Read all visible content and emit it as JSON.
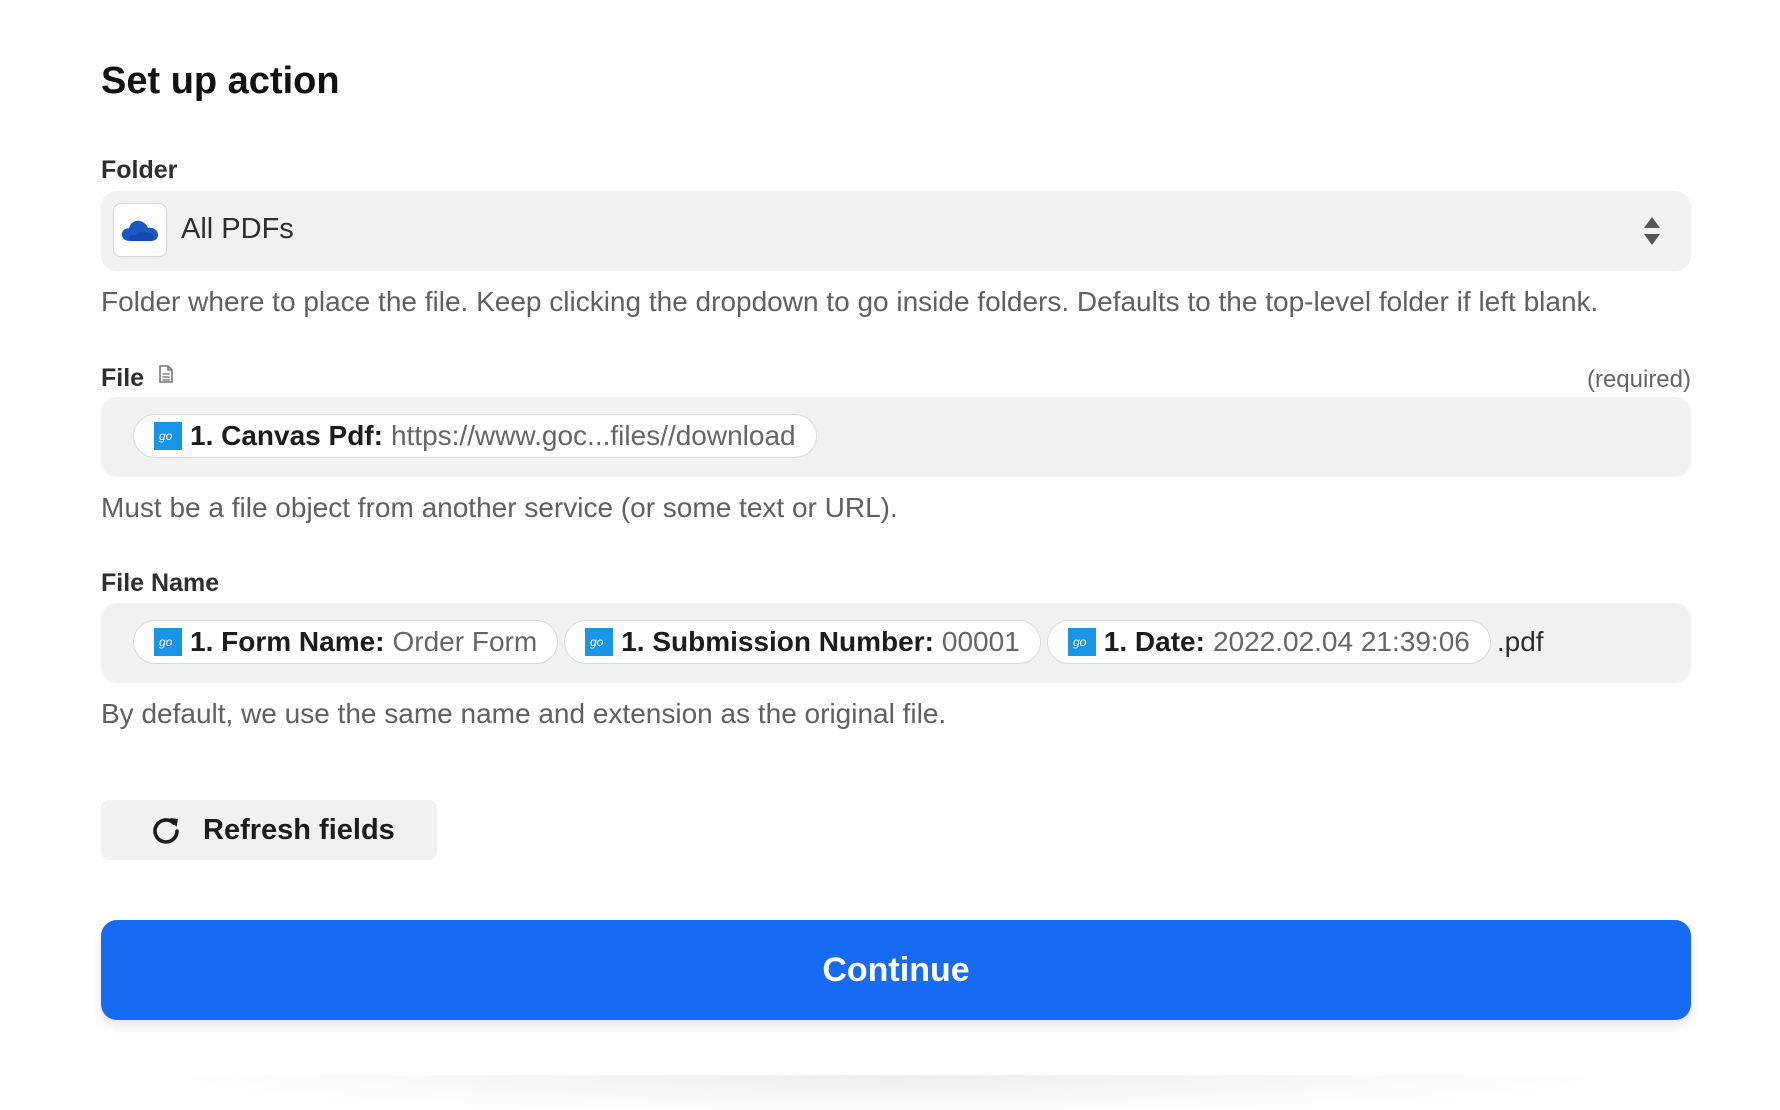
{
  "title": "Set up action",
  "folder": {
    "label": "Folder",
    "value": "All PDFs",
    "app_icon": "onedrive-cloud-icon",
    "help": "Folder where to place the file. Keep clicking the dropdown to go inside folders. Defaults to the top-level folder if left blank."
  },
  "file": {
    "label": "File",
    "label_icon": "document-icon",
    "required": "(required)",
    "pills": [
      {
        "icon": "go-canvas-icon",
        "key": "1. Canvas Pdf:",
        "value": "https://www.goc...files//download"
      }
    ],
    "help": "Must be a file object from another service (or some text or URL)."
  },
  "file_name": {
    "label": "File Name",
    "pills": [
      {
        "icon": "go-canvas-icon",
        "key": "1. Form Name:",
        "value": "Order Form"
      },
      {
        "icon": "go-canvas-icon",
        "key": "1. Submission Number:",
        "value": "00001"
      },
      {
        "icon": "go-canvas-icon",
        "key": "1. Date:",
        "value": "2022.02.04 21:39:06"
      }
    ],
    "suffix": ".pdf",
    "help": "By default, we use the same name and extension as the original file."
  },
  "buttons": {
    "refresh_label": "Refresh fields",
    "continue_label": "Continue"
  },
  "colors": {
    "accent": "#176bf2",
    "pill_icon": "#1a94e6",
    "onedrive": "#1b58c4"
  }
}
